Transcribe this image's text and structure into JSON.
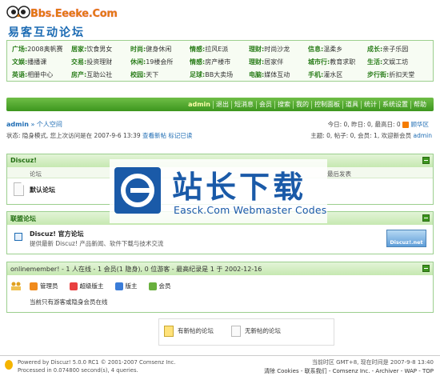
{
  "header": {
    "site": "Bbs.Eeeke.Com",
    "name": "易客互动论坛"
  },
  "categories": [
    [
      {
        "k": "广场:",
        "v": "2008奥帆赛"
      },
      {
        "k": "居家:",
        "v": "饮食男女"
      },
      {
        "k": "时尚:",
        "v": "健身休闲"
      },
      {
        "k": "情感:",
        "v": "拉风E派"
      },
      {
        "k": "理财:",
        "v": "时尚沙龙"
      },
      {
        "k": "信息:",
        "v": "温柔乡"
      },
      {
        "k": "成长:",
        "v": "亲子乐园"
      }
    ],
    [
      {
        "k": "文娱:",
        "v": "播播课"
      },
      {
        "k": "交易:",
        "v": "投资理财"
      },
      {
        "k": "休闲:",
        "v": "19楼会所"
      },
      {
        "k": "情感:",
        "v": "房产楼市"
      },
      {
        "k": "理财:",
        "v": "居家伴"
      },
      {
        "k": "城市行:",
        "v": "教育求职"
      },
      {
        "k": "生活:",
        "v": "文娱工坊"
      }
    ],
    [
      {
        "k": "英语:",
        "v": "相册中心"
      },
      {
        "k": "房产:",
        "v": "互助公社"
      },
      {
        "k": "校园:",
        "v": "天下"
      },
      {
        "k": "足球:",
        "v": "BB大卖场"
      },
      {
        "k": "电脑:",
        "v": "媒体互动"
      },
      {
        "k": "手机:",
        "v": "灌水区"
      },
      {
        "k": "步行街:",
        "v": "折扣天堂"
      }
    ]
  ],
  "nav": [
    "admin",
    "退出",
    "短消息",
    "会员",
    "搜索",
    "我的",
    "控制面板",
    "道具",
    "统计",
    "系统设置",
    "帮助"
  ],
  "breadcrumb": {
    "user": "admin",
    "sep": " » ",
    "section": "个人空间"
  },
  "status_line": {
    "text": "状态: 隐身模式, 您上次访问是在 2007-9-6 13:39",
    "link1": "查看新帖",
    "link2": "标记已读"
  },
  "stats": {
    "line1": "今日: 0, 昨日: 0, 最高日: 0",
    "rss": "顾华区",
    "line2": "主题: 0, 帖子: 0, 会员: 1, 欢迎新会员",
    "newmember": "admin"
  },
  "section1": {
    "title": "Discuz!",
    "col_forum": "论坛",
    "col_lastpost": "最后发表",
    "forum": "默认论坛"
  },
  "section2": {
    "title": "联盟论坛",
    "forum": "Discuz! 官方论坛",
    "desc": "提供最新 Discuz! 产品新闻、软件下载与技术交流",
    "badge": "Discuz!.net"
  },
  "section3": {
    "title": "onlinemember! - 1 人在线 - 1 会员(1 隐身), 0 位游客 - 最高纪录是 1 于 2002-12-16",
    "groups": [
      {
        "label": "管理员",
        "color": "#f08a1c"
      },
      {
        "label": "超级版主",
        "color": "#e84040"
      },
      {
        "label": "版主",
        "color": "#3a7cd8"
      },
      {
        "label": "会员",
        "color": "#69b03e"
      }
    ],
    "hint": "当前只有游客或隐身会员在线"
  },
  "legend": {
    "new": "有新帖的论坛",
    "nonew": "无新帖的论坛"
  },
  "footer": {
    "powered": "Powered by Discuz! 5.0.0 RC1 © 2001-2007 Comsenz Inc.",
    "processed": "Processed in 0.074800 second(s), 4 queries.",
    "time": "当前时区 GMT+8, 现在时间是 2007-9-8 13:40",
    "links": "清除 Cookies - 联系我们 - Comsenz Inc. - Archiver - WAP - TOP"
  },
  "watermark": {
    "title": "站长下载",
    "sub": "Easck.Com Webmaster Codes"
  }
}
